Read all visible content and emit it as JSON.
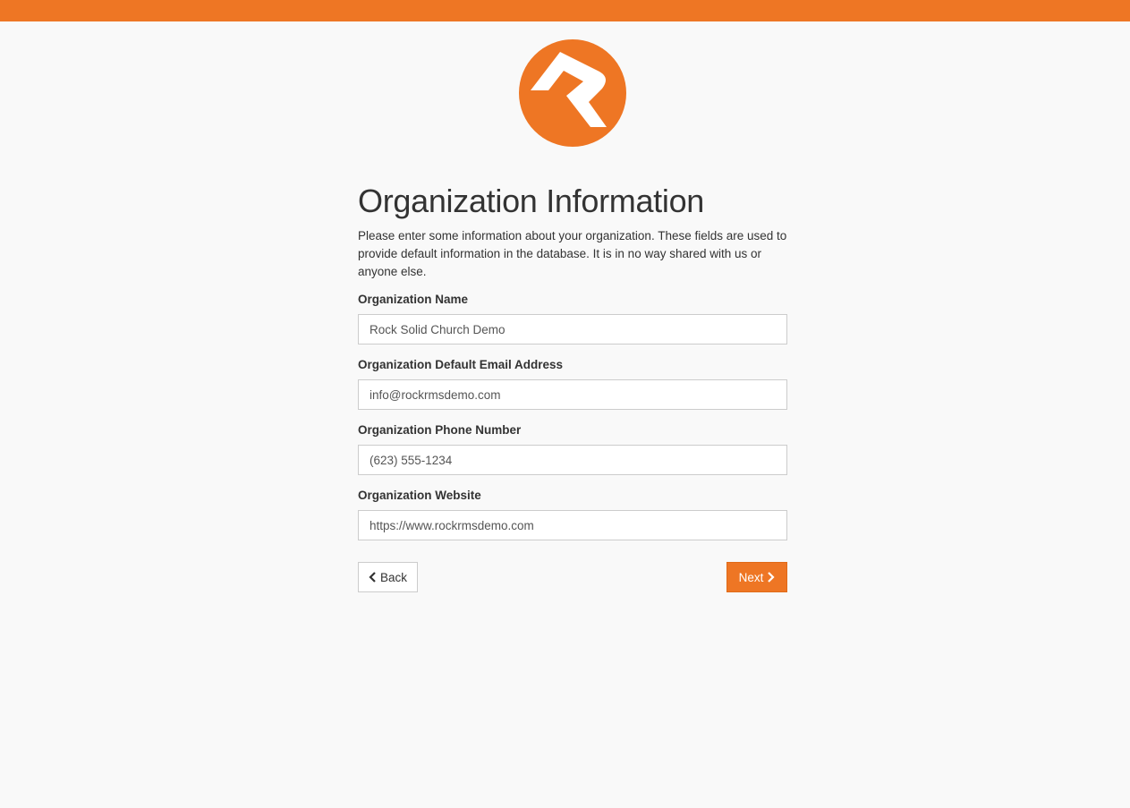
{
  "page": {
    "title": "Organization Information",
    "intro": "Please enter some information about your organization. These fields are used to provide default information in the database. It is in no way shared with us or anyone else."
  },
  "colors": {
    "brand": "#ee7624",
    "background": "#f9f9f9",
    "text": "#333333"
  },
  "logo": {
    "icon": "rock-rms-logo-icon"
  },
  "form": {
    "fields": [
      {
        "label": "Organization Name",
        "value": "Rock Solid Church Demo"
      },
      {
        "label": "Organization Default Email Address",
        "value": "info@rockrmsdemo.com"
      },
      {
        "label": "Organization Phone Number",
        "value": "(623) 555-1234"
      },
      {
        "label": "Organization Website",
        "value": "https://www.rockrmsdemo.com"
      }
    ]
  },
  "actions": {
    "back_label": "Back",
    "back_icon": "chevron-left-icon",
    "next_label": "Next",
    "next_icon": "chevron-right-icon"
  }
}
